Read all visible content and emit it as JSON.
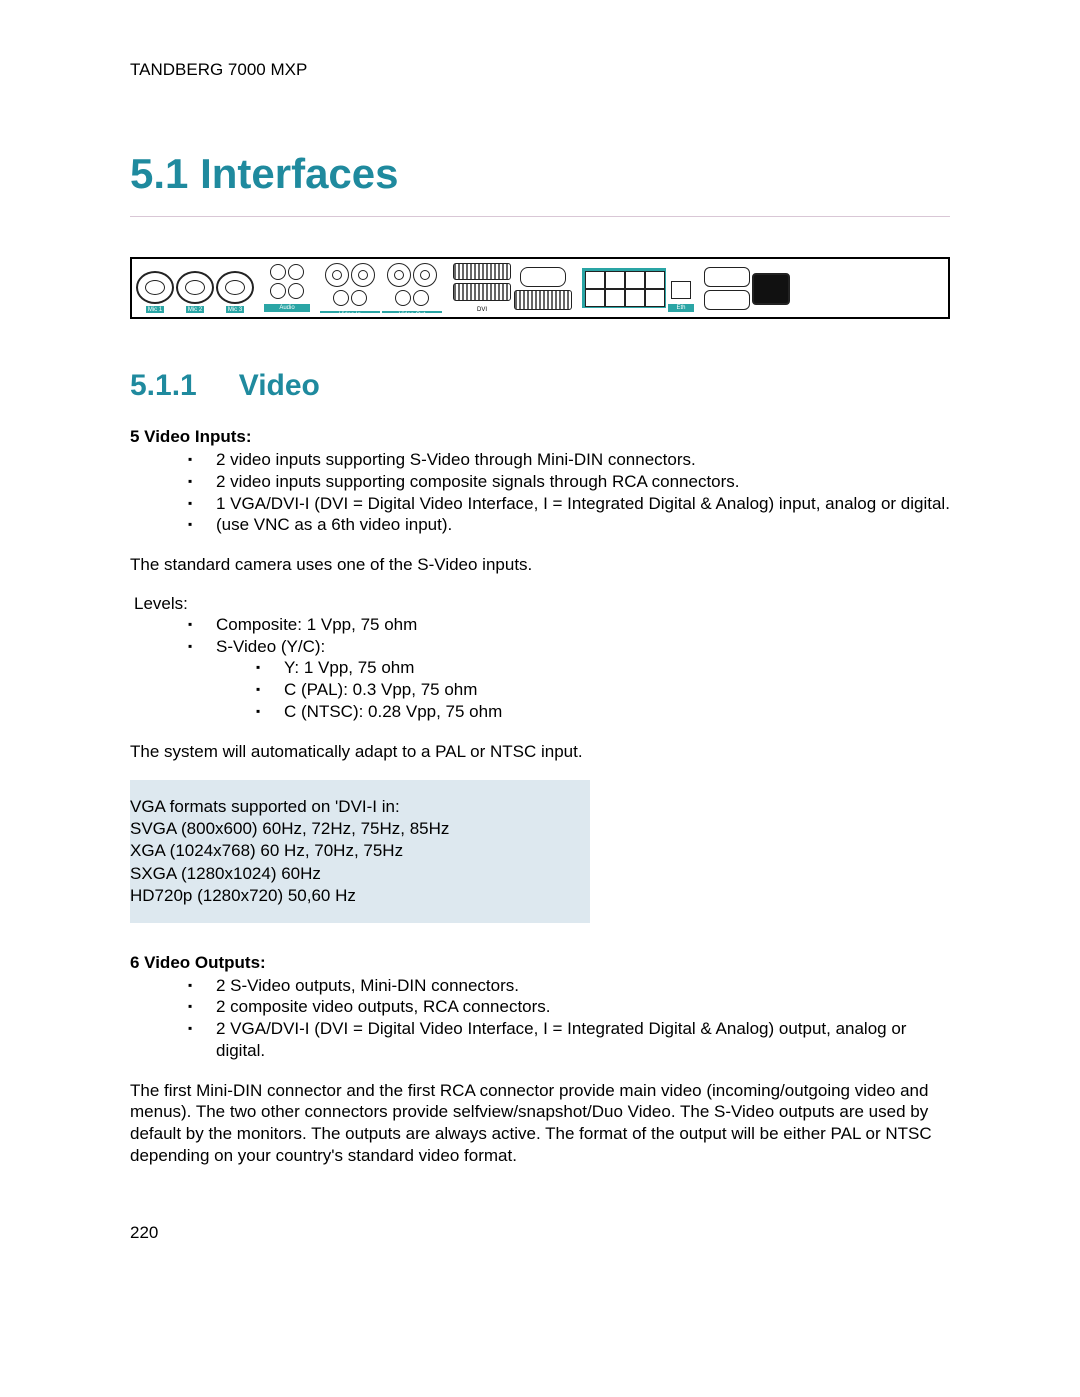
{
  "header": "TANDBERG 7000 MXP",
  "section": {
    "number": "5.1",
    "title": "Interfaces"
  },
  "subsection": {
    "number": "5.1.1",
    "title": "Video"
  },
  "video_inputs": {
    "heading": "5 Video Inputs:",
    "items": [
      "2 video inputs supporting S-Video through Mini-DIN connectors.",
      "2 video inputs supporting composite signals through RCA connectors.",
      "1 VGA/DVI-I (DVI = Digital Video Interface, I = Integrated Digital & Analog) input, analog or digital.",
      "(use VNC as a 6th video input)."
    ]
  },
  "camera_note": "The standard camera uses one of the S-Video inputs.",
  "levels": {
    "label": "Levels:",
    "items": [
      "Composite: 1 Vpp, 75 ohm",
      "S-Video (Y/C):"
    ],
    "svideo_sub": [
      "Y: 1 Vpp, 75 ohm",
      "C (PAL): 0.3 Vpp, 75 ohm",
      "C (NTSC): 0.28 Vpp, 75 ohm"
    ]
  },
  "pal_note": "The system will automatically adapt to a PAL or NTSC input.",
  "vga_box": {
    "l1": "VGA formats supported on 'DVI-I in:",
    "l2": "SVGA (800x600) 60Hz, 72Hz, 75Hz, 85Hz",
    "l3": "XGA (1024x768) 60 Hz, 70Hz, 75Hz",
    "l4": "SXGA (1280x1024) 60Hz",
    "l5": "HD720p (1280x720) 50,60 Hz"
  },
  "video_outputs": {
    "heading": "6 Video Outputs:",
    "items": [
      "2 S-Video outputs, Mini-DIN connectors.",
      "2 composite video outputs, RCA connectors.",
      "2 VGA/DVI-I (DVI = Digital Video Interface, I = Integrated Digital & Analog) output, analog or digital."
    ]
  },
  "outputs_para": "The first Mini-DIN connector and the first RCA connector provide main video (incoming/outgoing video and menus). The two other connectors provide selfview/snapshot/Duo Video. The S-Video outputs are used by default by the monitors. The outputs are always active. The format of the output will be either PAL or NTSC depending on your country's standard video format.",
  "page_number": "220"
}
